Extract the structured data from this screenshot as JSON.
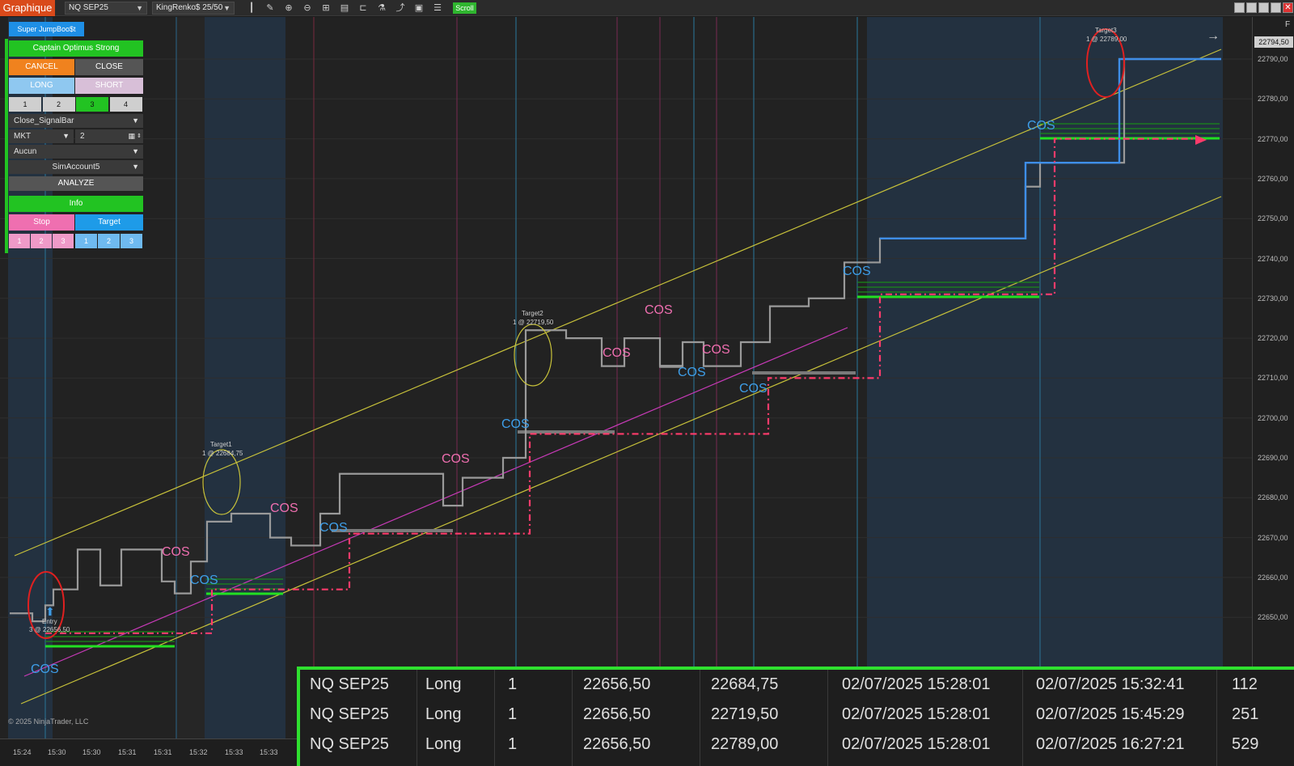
{
  "toolbar": {
    "tab_label": "Graphique",
    "instrument": "NQ SEP25",
    "bar_type": "KingRenko$ 25/50",
    "scroll_label": "Scroll"
  },
  "panel": {
    "indicator_button": "Super JumpBoo$t",
    "strategy_title": "Captain Optimus Strong",
    "cancel": "CANCEL",
    "close": "CLOSE",
    "long": "LONG",
    "short": "SHORT",
    "qty_options": [
      "1",
      "2",
      "3",
      "4"
    ],
    "qty_selected": "3",
    "signal_mode": "Close_SignalBar",
    "order_type": "MKT",
    "order_qty": "2",
    "atm": "Aucun",
    "account": "SimAccount5",
    "analyze": "ANALYZE",
    "info": "Info",
    "stop": "Stop",
    "target": "Target",
    "stop_levels": [
      "1",
      "2",
      "3"
    ],
    "target_levels": [
      "1",
      "2",
      "3"
    ]
  },
  "price_axis": {
    "current": "22794,50",
    "labels": [
      "22790,00",
      "22780,00",
      "22770,00",
      "22760,00",
      "22750,00",
      "22740,00",
      "22730,00",
      "22720,00",
      "22710,00",
      "22700,00",
      "22690,00",
      "22680,00",
      "22670,00",
      "22660,00",
      "22650,00"
    ],
    "corner": "F"
  },
  "time_axis": {
    "labels": [
      "15:24",
      "15:30",
      "15:30",
      "15:31",
      "15:31",
      "15:32",
      "15:33",
      "15:33"
    ]
  },
  "annotations": {
    "cos": "COS",
    "entry": "Entry",
    "entry_price": "3 @ 22656,50",
    "target1": "Target1",
    "target1_price": "1 @ 22684,75",
    "target2": "Target2",
    "target2_price": "1 @ 22719,50",
    "target3": "Target3",
    "target3_price": "1 @ 22789,00"
  },
  "copyright": "© 2025 NinjaTrader, LLC",
  "colors": {
    "accent_green": "#2fe02f",
    "cancel_orange": "#f0821e",
    "stop_pink": "#ef6fb0",
    "target_blue": "#1e9be8",
    "long_blue": "#8fc8f0",
    "short_pink": "#d8bfd8",
    "price_blue": "#3e8ee8",
    "channel_yellow": "#c8c23a",
    "stop_line": "#ff3b6b"
  },
  "trades": [
    {
      "instrument": "NQ SEP25",
      "side": "Long",
      "qty": "1",
      "entry": "22656,50",
      "exit": "22684,75",
      "entry_time": "02/07/2025 15:28:01",
      "exit_time": "02/07/2025 15:32:41",
      "ticks": "112"
    },
    {
      "instrument": "NQ SEP25",
      "side": "Long",
      "qty": "1",
      "entry": "22656,50",
      "exit": "22719,50",
      "entry_time": "02/07/2025 15:28:01",
      "exit_time": "02/07/2025 15:45:29",
      "ticks": "251"
    },
    {
      "instrument": "NQ SEP25",
      "side": "Long",
      "qty": "1",
      "entry": "22656,50",
      "exit": "22789,00",
      "entry_time": "02/07/2025 15:28:01",
      "exit_time": "02/07/2025 16:27:21",
      "ticks": "529"
    }
  ]
}
